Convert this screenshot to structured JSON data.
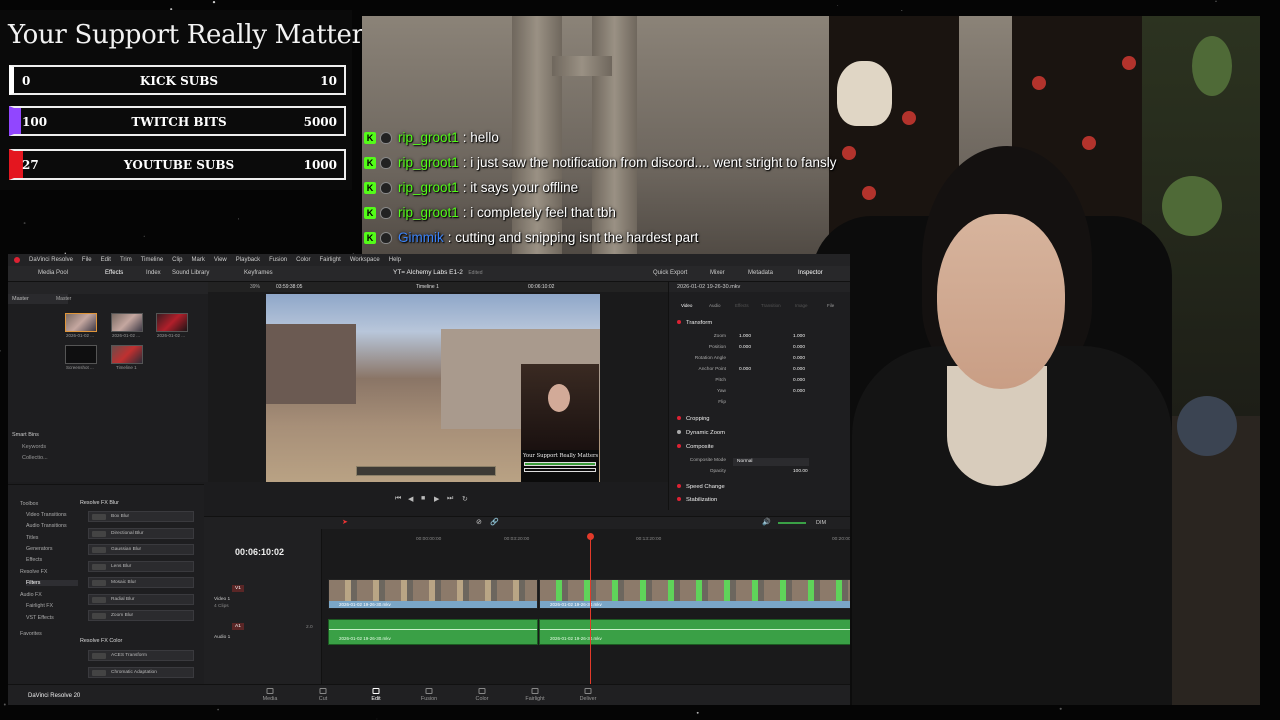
{
  "goals": {
    "title": "Your Support Really Matters",
    "bars": [
      {
        "current": "0",
        "label": "KICK SUBS",
        "goal": "10",
        "accent": "#ffffff",
        "progress": 0
      },
      {
        "current": "100",
        "label": "TWITCH BITS",
        "goal": "5000",
        "accent": "#9146ff",
        "progress": 0.02
      },
      {
        "current": "27",
        "label": "YOUTUBE SUBS",
        "goal": "1000",
        "accent": "#e4161f",
        "progress": 0.027
      }
    ]
  },
  "chat": {
    "messages": [
      {
        "user": "rip_groot1",
        "text": ": hello",
        "user_color": "#53fc18",
        "badge": "K"
      },
      {
        "user": "rip_groot1",
        "text": ": i just saw the notification from discord.... went stright to fansly",
        "user_color": "#53fc18",
        "badge": "K"
      },
      {
        "user": "rip_groot1",
        "text": ": it says your offline",
        "user_color": "#53fc18",
        "badge": "K"
      },
      {
        "user": "rip_groot1",
        "text": ": i completely feel that tbh",
        "user_color": "#53fc18",
        "badge": "K"
      },
      {
        "user": "Gimmik",
        "text": ": cutting and snipping isnt the hardest part",
        "user_color": "#3b82f6",
        "badge": "K"
      }
    ]
  },
  "resolve": {
    "menu": [
      "DaVinci Resolve",
      "File",
      "Edit",
      "Trim",
      "Timeline",
      "Clip",
      "Mark",
      "View",
      "Playback",
      "Fusion",
      "Color",
      "Fairlight",
      "Workspace",
      "Help"
    ],
    "toolbar": {
      "media_pool": "Media Pool",
      "effects": "Effects",
      "index": "Index",
      "sound_library": "Sound Library",
      "keyframes": "Keyframes",
      "project_title": "YT= Alchemy Labs E1-2",
      "project_status": "Edited",
      "quick_export": "Quick Export",
      "mixer": "Mixer",
      "metadata": "Metadata",
      "inspector": "Inspector"
    },
    "media_pool": {
      "bins": [
        "Master",
        "Master"
      ],
      "clips": [
        "2026-01-02 ...",
        "2026-01-02 ...",
        "2026-01-02 ...",
        "Screenshot ...",
        "Timeline 1"
      ],
      "smart_bins": "Smart Bins",
      "smart_items": [
        "Keywords",
        "Collectio..."
      ]
    },
    "viewer": {
      "zoom": "39%",
      "duration": "03:59:38:05",
      "timeline_name": "Timeline 1",
      "timecode": "00:06:10:02",
      "pip_overlay": "Your Support Really Matters"
    },
    "inspector": {
      "clip": "2026-01-02 19-26-30.mkv",
      "tabs": [
        "Video",
        "Audio",
        "Effects",
        "Transition",
        "Image",
        "File"
      ],
      "sections": {
        "transform": "Transform",
        "cropping": "Cropping",
        "dynamic_zoom": "Dynamic Zoom",
        "composite": "Composite",
        "speed_change": "Speed Change",
        "stabilization": "Stabilization"
      },
      "rows": [
        {
          "name": "Zoom",
          "a": "1.000",
          "b": "1.000"
        },
        {
          "name": "Position",
          "a": "0.000",
          "b": "0.000"
        },
        {
          "name": "Rotation Angle",
          "a": "",
          "b": "0.000"
        },
        {
          "name": "Anchor Point",
          "a": "0.000",
          "b": "0.000"
        },
        {
          "name": "Pitch",
          "a": "",
          "b": "0.000"
        },
        {
          "name": "Yaw",
          "a": "",
          "b": "0.000"
        },
        {
          "name": "Flip",
          "a": "",
          "b": ""
        }
      ],
      "composite_mode_label": "Composite Mode",
      "composite_mode": "Normal",
      "opacity_label": "Opacity",
      "opacity": "100.00"
    },
    "effects": {
      "tree": [
        "Toolbox",
        "Video Transitions",
        "Audio Transitions",
        "Titles",
        "Generators",
        "Effects",
        "Resolve FX",
        "Filters",
        "Audio FX",
        "Fairlight FX",
        "VST Effects",
        "Favorites"
      ],
      "group1": "Resolve FX Blur",
      "items1": [
        "Box Blur",
        "Directional Blur",
        "Gaussian Blur",
        "Lens Blur",
        "Mosaic Blur",
        "Radial Blur",
        "Zoom Blur"
      ],
      "group2": "Resolve FX Color",
      "items2": [
        "ACES Transform",
        "Chromatic Adaptation"
      ]
    },
    "timeline": {
      "timecode": "00:06:10:02",
      "ruler": [
        "00:00:00:00",
        "00:03:20:00",
        "00:13:20:00",
        "00:20:00"
      ],
      "video_track": "Video 1",
      "video_track_sub": "4 Clips",
      "audio_track": "Audio 1",
      "v_badge": "V1",
      "a_badge": "A1",
      "audio_level": "2.0",
      "dim": "DIM",
      "clip_name": "2026-01-02 19-26-30.mkv"
    },
    "pages": [
      "Media",
      "Cut",
      "Edit",
      "Fusion",
      "Color",
      "Fairlight",
      "Deliver"
    ],
    "active_page": "Edit",
    "brand": "DaVinci Resolve 20"
  }
}
